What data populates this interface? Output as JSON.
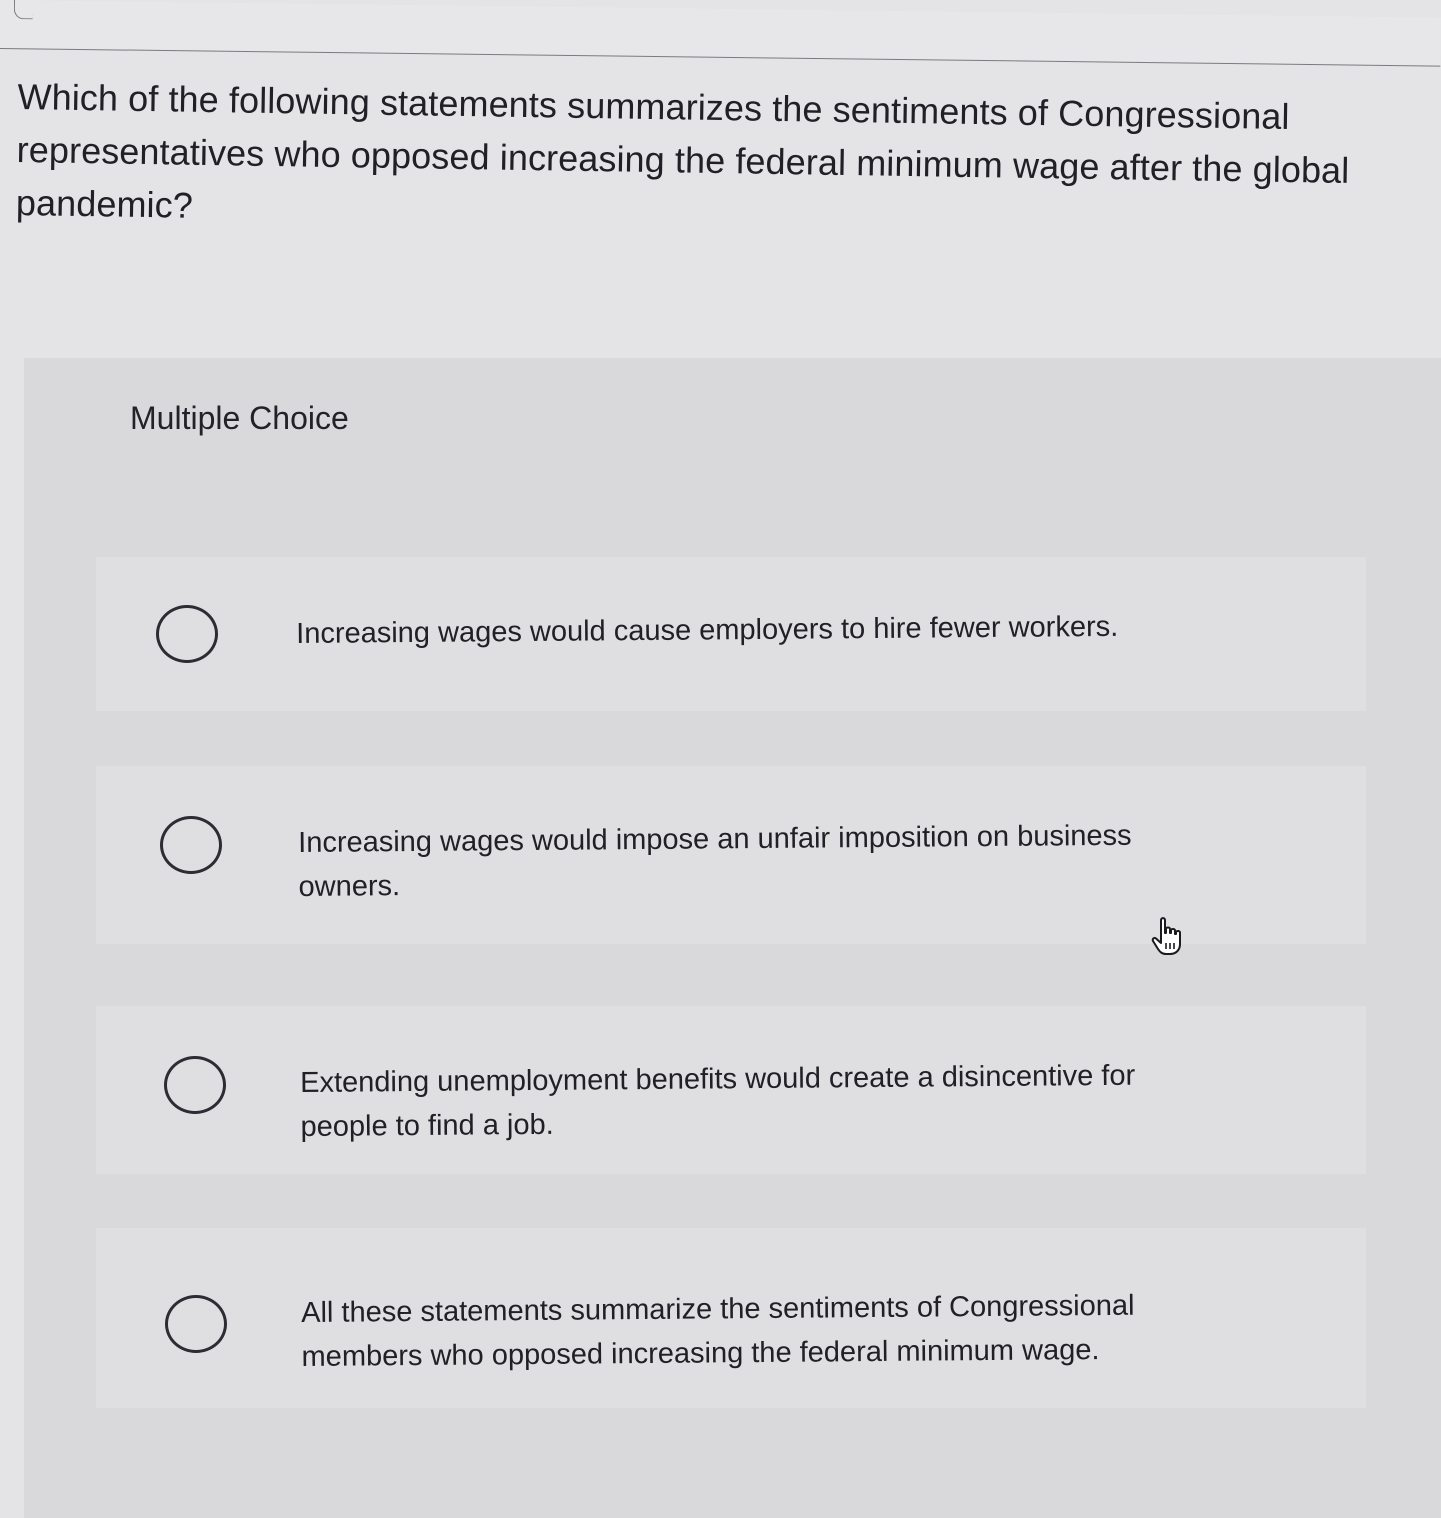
{
  "question": {
    "text": "Which of the following statements summarizes the sentiments of Congressional representatives who opposed increasing the federal minimum wage after the global pandemic?"
  },
  "multiple_choice": {
    "label": "Multiple Choice",
    "options": [
      {
        "text": "Increasing wages would cause employers to hire fewer workers.",
        "selected": false
      },
      {
        "text": "Increasing wages would impose an unfair imposition on business owners.",
        "selected": false
      },
      {
        "text": "Extending unemployment benefits would create a disincentive for people to find a job.",
        "selected": false
      },
      {
        "text": "All these statements summarize the sentiments of Congressional members who opposed increasing the federal minimum wage.",
        "selected": false
      }
    ]
  },
  "cursor": {
    "icon": "pointer-hand-icon"
  }
}
